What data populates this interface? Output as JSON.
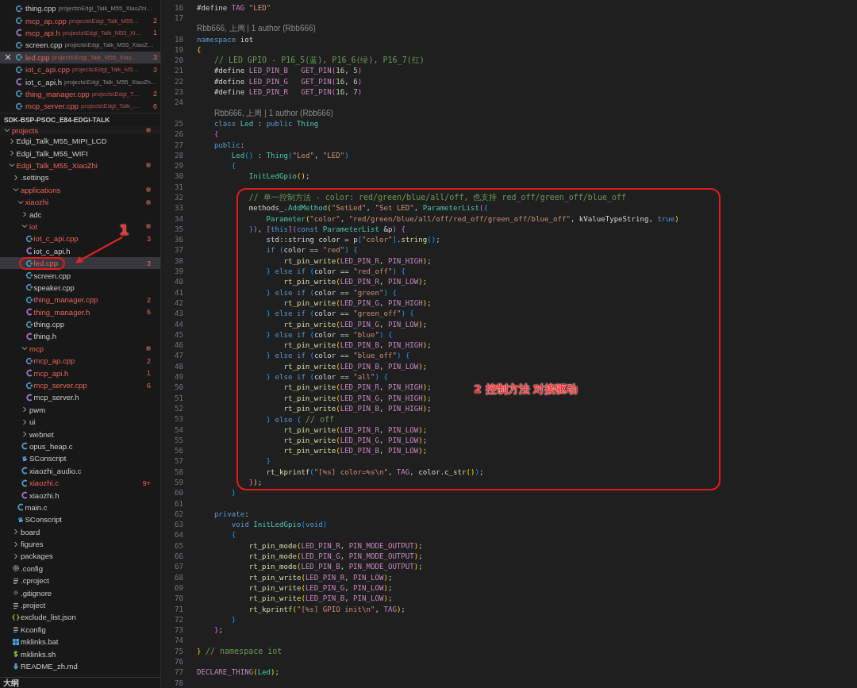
{
  "open_editors": [
    {
      "name": "thing.cpp",
      "path": "projects\\Edgi_Talk_M55_XiaoZhi…",
      "kind": "cpp",
      "modified": false,
      "selected": false
    },
    {
      "name": "mcp_ap.cpp",
      "path": "projects\\Edgi_Talk_M55…",
      "kind": "cpp",
      "modified": true,
      "badge": "2",
      "selected": false
    },
    {
      "name": "mcp_api.h",
      "path": "projects\\Edgi_Talk_M55_Xi…",
      "kind": "h",
      "modified": true,
      "badge": "1",
      "selected": false
    },
    {
      "name": "screen.cpp",
      "path": "projects\\Edgi_Talk_M55_XiaoZ…",
      "kind": "cpp",
      "modified": false,
      "selected": false
    },
    {
      "name": "led.cpp",
      "path": "projects\\Edgi_Talk_M55_Xiao…",
      "kind": "cpp",
      "modified": true,
      "badge": "3",
      "selected": true
    },
    {
      "name": "iot_c_api.cpp",
      "path": "projects\\Edgi_Talk_M5…",
      "kind": "cpp",
      "modified": true,
      "badge": "3",
      "selected": false
    },
    {
      "name": "iot_c_api.h",
      "path": "projects\\Edgi_Talk_M55_XiaoZh…",
      "kind": "h",
      "modified": false,
      "selected": false
    },
    {
      "name": "thing_manager.cpp",
      "path": "projects\\Edgi_T…",
      "kind": "cpp",
      "modified": true,
      "badge": "2",
      "selected": false
    },
    {
      "name": "mcp_server.cpp",
      "path": "projects\\Edgi_Talk_…",
      "kind": "cpp",
      "modified": true,
      "badge": "6",
      "selected": false
    }
  ],
  "explorer": {
    "title": "SDK-BSP-PSOC_E84-EDGI-TALK",
    "tree": [
      {
        "name": "projects",
        "kind": "folder",
        "expanded": true,
        "modified": true,
        "dot": true,
        "selected": false,
        "children": [
          {
            "name": "Edgi_Talk_M55_MIPI_LCD",
            "kind": "folder",
            "expanded": false,
            "modified": false,
            "dot": false,
            "selected": false
          },
          {
            "name": "Edgi_Talk_M55_WIFI",
            "kind": "folder",
            "expanded": false,
            "modified": false,
            "dot": false,
            "selected": false
          },
          {
            "name": "Edgi_Talk_M55_XiaoZhi",
            "kind": "folder",
            "expanded": true,
            "modified": true,
            "dot": true,
            "selected": false,
            "children": [
              {
                "name": ".settings",
                "kind": "folder",
                "expanded": false,
                "modified": false,
                "dot": false,
                "selected": false
              },
              {
                "name": "applications",
                "kind": "folder",
                "expanded": true,
                "modified": true,
                "dot": true,
                "selected": false,
                "children": [
                  {
                    "name": "xiaozhi",
                    "kind": "folder",
                    "expanded": true,
                    "modified": true,
                    "dot": true,
                    "selected": false,
                    "children": [
                      {
                        "name": "adc",
                        "kind": "folder",
                        "expanded": false,
                        "modified": false,
                        "dot": false,
                        "selected": false
                      },
                      {
                        "name": "iot",
                        "kind": "folder",
                        "expanded": true,
                        "modified": true,
                        "dot": true,
                        "selected": false,
                        "children": [
                          {
                            "name": "iot_c_api.cpp",
                            "kind": "cpp",
                            "modified": true,
                            "badge": "3",
                            "selected": false
                          },
                          {
                            "name": "iot_c_api.h",
                            "kind": "h",
                            "modified": false,
                            "selected": false
                          },
                          {
                            "name": "led.cpp",
                            "kind": "cpp",
                            "modified": true,
                            "badge": "3",
                            "selected": true
                          },
                          {
                            "name": "screen.cpp",
                            "kind": "cpp",
                            "modified": false,
                            "selected": false
                          },
                          {
                            "name": "speaker.cpp",
                            "kind": "cpp",
                            "modified": false,
                            "selected": false
                          },
                          {
                            "name": "thing_manager.cpp",
                            "kind": "cpp",
                            "modified": true,
                            "badge": "2",
                            "selected": false
                          },
                          {
                            "name": "thing_manager.h",
                            "kind": "h",
                            "modified": true,
                            "badge": "6",
                            "selected": false
                          },
                          {
                            "name": "thing.cpp",
                            "kind": "cpp",
                            "modified": false,
                            "selected": false
                          },
                          {
                            "name": "thing.h",
                            "kind": "h",
                            "modified": false,
                            "selected": false
                          }
                        ]
                      },
                      {
                        "name": "mcp",
                        "kind": "folder",
                        "expanded": true,
                        "modified": true,
                        "dot": true,
                        "selected": false,
                        "children": [
                          {
                            "name": "mcp_ap.cpp",
                            "kind": "cpp",
                            "modified": true,
                            "badge": "2",
                            "selected": false
                          },
                          {
                            "name": "mcp_api.h",
                            "kind": "h",
                            "modified": true,
                            "badge": "1",
                            "selected": false
                          },
                          {
                            "name": "mcp_server.cpp",
                            "kind": "cpp",
                            "modified": true,
                            "badge": "6",
                            "selected": false
                          },
                          {
                            "name": "mcp_server.h",
                            "kind": "h",
                            "modified": false,
                            "selected": false
                          }
                        ]
                      },
                      {
                        "name": "pwm",
                        "kind": "folder",
                        "expanded": false,
                        "modified": false,
                        "dot": false,
                        "selected": false
                      },
                      {
                        "name": "ui",
                        "kind": "folder",
                        "expanded": false,
                        "modified": false,
                        "dot": false,
                        "selected": false
                      },
                      {
                        "name": "webnet",
                        "kind": "folder",
                        "expanded": false,
                        "modified": false,
                        "dot": false,
                        "selected": false
                      },
                      {
                        "name": "opus_heap.c",
                        "kind": "c",
                        "modified": false,
                        "selected": false
                      },
                      {
                        "name": "SConscript",
                        "kind": "python",
                        "modified": false,
                        "selected": false
                      },
                      {
                        "name": "xiaozhi_audio.c",
                        "kind": "c",
                        "modified": false,
                        "selected": false
                      },
                      {
                        "name": "xiaozhi.c",
                        "kind": "c",
                        "modified": true,
                        "badge": "9+",
                        "selected": false
                      },
                      {
                        "name": "xiaozhi.h",
                        "kind": "h",
                        "modified": false,
                        "selected": false
                      }
                    ]
                  },
                  {
                    "name": "main.c",
                    "kind": "c",
                    "modified": false,
                    "selected": false
                  },
                  {
                    "name": "SConscript",
                    "kind": "python",
                    "modified": false,
                    "selected": false
                  }
                ]
              },
              {
                "name": "board",
                "kind": "folder",
                "expanded": false,
                "modified": false,
                "dot": false,
                "selected": false
              },
              {
                "name": "figures",
                "kind": "folder",
                "expanded": false,
                "modified": false,
                "dot": false,
                "selected": false
              },
              {
                "name": "packages",
                "kind": "folder",
                "expanded": false,
                "modified": false,
                "dot": false,
                "selected": false
              },
              {
                "name": ".config",
                "kind": "gear",
                "modified": false,
                "selected": false
              },
              {
                "name": ".cproject",
                "kind": "lines",
                "modified": false,
                "selected": false
              },
              {
                "name": ".gitignore",
                "kind": "diamond",
                "modified": false,
                "selected": false
              },
              {
                "name": ".project",
                "kind": "lines",
                "modified": false,
                "selected": false
              },
              {
                "name": "exclude_list.json",
                "kind": "json",
                "modified": false,
                "selected": false
              },
              {
                "name": "Kconfig",
                "kind": "lines",
                "modified": false,
                "selected": false
              },
              {
                "name": "mklinks.bat",
                "kind": "windows",
                "modified": false,
                "selected": false
              },
              {
                "name": "mklinks.sh",
                "kind": "dollar",
                "modified": false,
                "selected": false
              },
              {
                "name": "README_zh.md",
                "kind": "markdown",
                "modified": false,
                "selected": false
              }
            ]
          }
        ]
      }
    ]
  },
  "outline": {
    "title": "大纲"
  },
  "editor": {
    "rows": [
      {
        "kind": "code",
        "number": "16",
        "text": "#define TAG \"LED\""
      },
      {
        "kind": "code",
        "number": "17"
      },
      {
        "kind": "blame",
        "text": "Rbb666, 上周 | 1 author (Rbb666)"
      },
      {
        "kind": "code",
        "number": "18",
        "text": "namespace iot"
      },
      {
        "kind": "code",
        "number": "19",
        "text": "{"
      },
      {
        "kind": "code",
        "number": "20",
        "text": "    // LED GPIO - P16_5(蓝), P16_6(绿), P16_7(红)"
      },
      {
        "kind": "code",
        "number": "21",
        "text": "    #define LED_PIN_B   GET_PIN(16, 5)"
      },
      {
        "kind": "code",
        "number": "22",
        "text": "    #define LED_PIN_G   GET_PIN(16, 6)"
      },
      {
        "kind": "code",
        "number": "23",
        "text": "    #define LED_PIN_R   GET_PIN(16, 7)"
      },
      {
        "kind": "code",
        "number": "24"
      },
      {
        "kind": "blame",
        "text": "Rbb666, 上周 | 1 author (Rbb666)"
      },
      {
        "kind": "code",
        "number": "25",
        "text": "    class Led : public Thing"
      },
      {
        "kind": "code",
        "number": "26",
        "text": "    {"
      },
      {
        "kind": "code",
        "number": "27",
        "text": "    public:"
      },
      {
        "kind": "code",
        "number": "28",
        "text": "        Led() : Thing(\"Led\", \"LED\")"
      },
      {
        "kind": "code",
        "number": "29",
        "text": "        {"
      },
      {
        "kind": "code",
        "number": "30",
        "text": "            InitLedGpio();"
      },
      {
        "kind": "code",
        "number": "31"
      },
      {
        "kind": "code",
        "number": "32",
        "text": "            // 单一控制方法 - color: red/green/blue/all/off, 也支持 red_off/green_off/blue_off"
      },
      {
        "kind": "code",
        "number": "33",
        "text": "            methods_.AddMethod(\"SetLed\", \"Set LED\", ParameterList({"
      },
      {
        "kind": "code",
        "number": "34",
        "text": "                Parameter(\"color\", \"red/green/blue/all/off/red_off/green_off/blue_off\", kValueTypeString, true)"
      },
      {
        "kind": "code",
        "number": "35",
        "text": "            }), [this](const ParameterList &p) {"
      },
      {
        "kind": "code",
        "number": "36",
        "text": "                std::string color = p[\"color\"].string();"
      },
      {
        "kind": "code",
        "number": "37",
        "text": "                if (color == \"red\") {"
      },
      {
        "kind": "code",
        "number": "38",
        "text": "                    rt_pin_write(LED_PIN_R, PIN_HIGH);"
      },
      {
        "kind": "code",
        "number": "39",
        "text": "                } else if (color == \"red_off\") {"
      },
      {
        "kind": "code",
        "number": "40",
        "text": "                    rt_pin_write(LED_PIN_R, PIN_LOW);"
      },
      {
        "kind": "code",
        "number": "41",
        "text": "                } else if (color == \"green\") {"
      },
      {
        "kind": "code",
        "number": "42",
        "text": "                    rt_pin_write(LED_PIN_G, PIN_HIGH);"
      },
      {
        "kind": "code",
        "number": "43",
        "text": "                } else if (color == \"green_off\") {"
      },
      {
        "kind": "code",
        "number": "44",
        "text": "                    rt_pin_write(LED_PIN_G, PIN_LOW);"
      },
      {
        "kind": "code",
        "number": "45",
        "text": "                } else if (color == \"blue\") {"
      },
      {
        "kind": "code",
        "number": "46",
        "text": "                    rt_pin_write(LED_PIN_B, PIN_HIGH);"
      },
      {
        "kind": "code",
        "number": "47",
        "text": "                } else if (color == \"blue_off\") {"
      },
      {
        "kind": "code",
        "number": "48",
        "text": "                    rt_pin_write(LED_PIN_B, PIN_LOW);"
      },
      {
        "kind": "code",
        "number": "49",
        "text": "                } else if (color == \"all\") {"
      },
      {
        "kind": "code",
        "number": "50",
        "text": "                    rt_pin_write(LED_PIN_R, PIN_HIGH);"
      },
      {
        "kind": "code",
        "number": "51",
        "text": "                    rt_pin_write(LED_PIN_G, PIN_HIGH);"
      },
      {
        "kind": "code",
        "number": "52",
        "text": "                    rt_pin_write(LED_PIN_B, PIN_HIGH);"
      },
      {
        "kind": "code",
        "number": "53",
        "text": "                } else { // off"
      },
      {
        "kind": "code",
        "number": "54",
        "text": "                    rt_pin_write(LED_PIN_R, PIN_LOW);"
      },
      {
        "kind": "code",
        "number": "55",
        "text": "                    rt_pin_write(LED_PIN_G, PIN_LOW);"
      },
      {
        "kind": "code",
        "number": "56",
        "text": "                    rt_pin_write(LED_PIN_B, PIN_LOW);"
      },
      {
        "kind": "code",
        "number": "57",
        "text": "                }"
      },
      {
        "kind": "code",
        "number": "58",
        "text": "                rt_kprintf(\"[%s] color=%s\\n\", TAG, color.c_str());"
      },
      {
        "kind": "code",
        "number": "59",
        "text": "            });"
      },
      {
        "kind": "code",
        "number": "60",
        "text": "        }"
      },
      {
        "kind": "code",
        "number": "61"
      },
      {
        "kind": "code",
        "number": "62",
        "text": "    private:"
      },
      {
        "kind": "code",
        "number": "63",
        "text": "        void InitLedGpio(void)"
      },
      {
        "kind": "code",
        "number": "64",
        "text": "        {"
      },
      {
        "kind": "code",
        "number": "65",
        "text": "            rt_pin_mode(LED_PIN_R, PIN_MODE_OUTPUT);"
      },
      {
        "kind": "code",
        "number": "66",
        "text": "            rt_pin_mode(LED_PIN_G, PIN_MODE_OUTPUT);"
      },
      {
        "kind": "code",
        "number": "67",
        "text": "            rt_pin_mode(LED_PIN_B, PIN_MODE_OUTPUT);"
      },
      {
        "kind": "code",
        "number": "68",
        "text": "            rt_pin_write(LED_PIN_R, PIN_LOW);"
      },
      {
        "kind": "code",
        "number": "69",
        "text": "            rt_pin_write(LED_PIN_G, PIN_LOW);"
      },
      {
        "kind": "code",
        "number": "70",
        "text": "            rt_pin_write(LED_PIN_B, PIN_LOW);"
      },
      {
        "kind": "code",
        "number": "71",
        "text": "            rt_kprintf(\"[%s] GPIO init\\n\", TAG);"
      },
      {
        "kind": "code",
        "number": "72",
        "text": "        }"
      },
      {
        "kind": "code",
        "number": "73",
        "text": "    };"
      },
      {
        "kind": "code",
        "number": "74"
      },
      {
        "kind": "code",
        "number": "75",
        "text": "} // namespace iot"
      },
      {
        "kind": "code",
        "number": "76"
      },
      {
        "kind": "code",
        "number": "77",
        "text": "DECLARE_THING(Led);"
      },
      {
        "kind": "code",
        "number": "78"
      }
    ]
  },
  "annotations": [
    {
      "kind": "sidebar_callout",
      "label": "1"
    },
    {
      "kind": "code_callout",
      "label": "2 控制方法 对接驱动"
    }
  ]
}
